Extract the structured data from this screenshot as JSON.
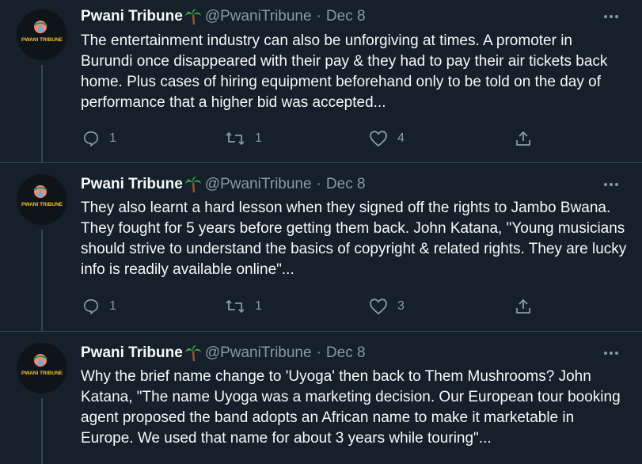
{
  "tweets": [
    {
      "name": "Pwani Tribune",
      "handle": "@PwaniTribune",
      "separator": "·",
      "date": "Dec 8",
      "avatar_text": "PWANI TRIBUNE",
      "text": "The entertainment industry can also be unforgiving at times. A promoter in Burundi once disappeared with their pay & they had to pay their air tickets back home. Plus cases of hiring equipment beforehand only to be told on the day of performance that a higher bid was accepted...",
      "replies": "1",
      "retweets": "1",
      "likes": "4"
    },
    {
      "name": "Pwani Tribune",
      "handle": "@PwaniTribune",
      "separator": "·",
      "date": "Dec 8",
      "avatar_text": "PWANI TRIBUNE",
      "text": "They also learnt a hard lesson when they signed off the rights to Jambo Bwana. They fought for 5 years before getting them back. John Katana, \"Young musicians should strive to understand the basics of copyright & related rights. They are lucky info is readily available online\"...",
      "replies": "1",
      "retweets": "1",
      "likes": "3"
    },
    {
      "name": "Pwani Tribune",
      "handle": "@PwaniTribune",
      "separator": "·",
      "date": "Dec 8",
      "avatar_text": "PWANI TRIBUNE",
      "text": "Why the brief name change to 'Uyoga' then back to Them Mushrooms? John Katana, \"The name Uyoga was a marketing decision. Our European tour booking agent proposed the band adopts an African name to make it marketable in Europe. We used that name for about 3 years while touring\"..."
    }
  ],
  "colors": {
    "background": "#15202b",
    "text": "#f7f9f9",
    "secondary": "#8b98a5",
    "border": "#38444d"
  },
  "icons": [
    "more-icon",
    "palm-tree-icon",
    "reply-icon",
    "retweet-icon",
    "like-icon",
    "share-icon"
  ]
}
